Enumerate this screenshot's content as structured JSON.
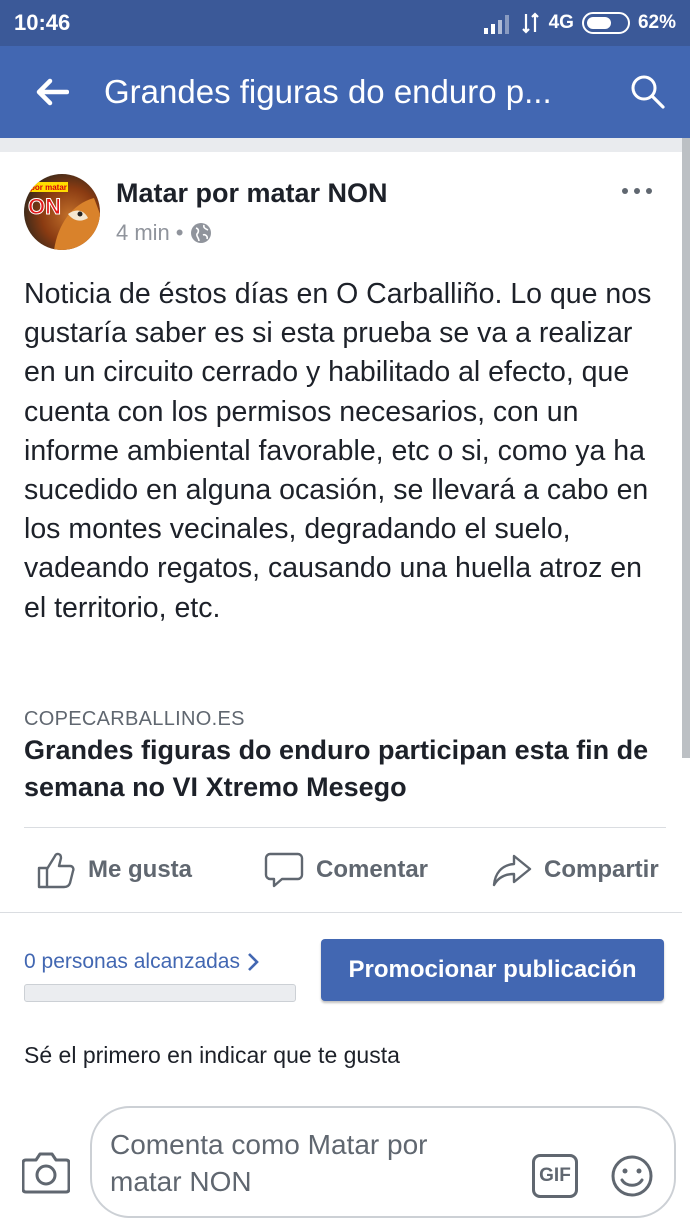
{
  "status_bar": {
    "time": "10:46",
    "network": "4G",
    "battery_percent": "62%",
    "battery_level": 0.62
  },
  "app_bar": {
    "back_icon": "arrow-left-icon",
    "title": "Grandes figuras do enduro p...",
    "search_icon": "search-icon"
  },
  "post": {
    "author": "Matar por matar NON",
    "avatar_text_top": "por matar",
    "avatar_text_main": "ON",
    "time_ago": "4 min",
    "separator": "•",
    "privacy_icon": "globe-icon",
    "more_icon": "more-horizontal-icon",
    "text": "Noticia de éstos días en O Carballiño. Lo que nos gustaría saber es si esta prueba se va a realizar en un circuito cerrado y habilitado al efecto, que cuenta con los permisos necesarios, con un informe ambiental favorable, etc o si, como ya ha sucedido en alguna ocasión, se llevará a cabo en los montes vecinales, degradando el suelo, vadeando regatos, causando una huella atroz en el territorio, etc.",
    "link": {
      "domain": "COPECARBALLINO.ES",
      "title": "Grandes figuras do enduro participan esta fin de semana no VI Xtremo Mesego"
    },
    "actions": {
      "like": "Me gusta",
      "comment": "Comentar",
      "share": "Compartir"
    },
    "reach": {
      "label": "0 personas alcanzadas",
      "progress": 0
    },
    "promote_button": "Promocionar publicación",
    "first_like": "Sé el primero en indicar que te gusta"
  },
  "composer": {
    "camera_icon": "camera-icon",
    "placeholder": "Comenta como Matar por matar NON",
    "gif_label": "GIF",
    "emoji_icon": "smiley-icon"
  },
  "colors": {
    "status_bar": "#3b5998",
    "app_bar": "#4267b2",
    "accent": "#4267b2",
    "text": "#1d2129",
    "muted": "#606770"
  }
}
